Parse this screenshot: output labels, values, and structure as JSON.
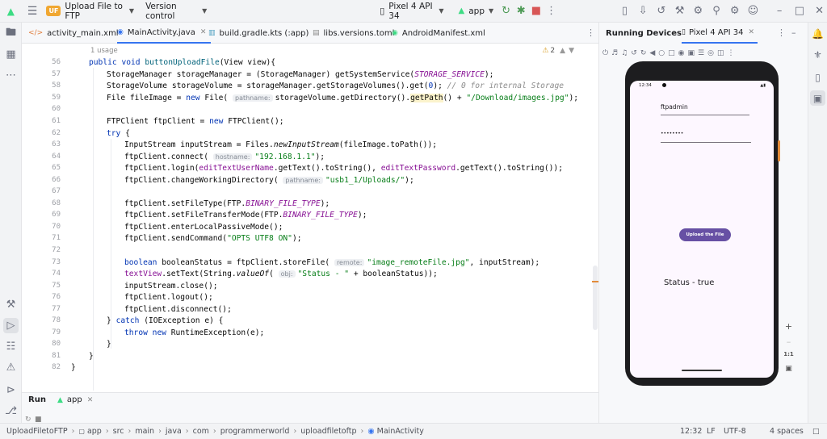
{
  "titlebar": {
    "project_badge": "UF",
    "project_name": "Upload File to FTP",
    "vcs": "Version control",
    "device": "Pixel 4 API 34",
    "run_config": "app"
  },
  "tabs": [
    "activity_main.xml",
    "MainActivity.java",
    "build.gradle.kts (:app)",
    "libs.versions.toml",
    "AndroidManifest.xml"
  ],
  "editor": {
    "usage": "1 usage",
    "warnings": "2",
    "line_numbers": [
      "56",
      "57",
      "58",
      "59",
      "60",
      "61",
      "62",
      "63",
      "64",
      "65",
      "66",
      "67",
      "68",
      "69",
      "70",
      "71",
      "72",
      "73",
      "74",
      "75",
      "76",
      "77",
      "78",
      "79",
      "80",
      "81",
      "82"
    ],
    "hints": {
      "pathname": "pathname:",
      "hostname": "hostname:",
      "remote": "remote:",
      "obj": "obj:"
    },
    "tokens": {
      "l56a": "public",
      "l56b": "void",
      "l56c": "buttonUploadFile",
      "l56d": "(View view){",
      "l57a": "StorageManager storageManager = (StorageManager) getSystemService(",
      "l57b": "STORAGE_SERVICE",
      "l57c": ");",
      "l58a": "StorageVolume storageVolume = storageManager.getStorageVolumes().get(",
      "l58b": "0",
      "l58c": "); ",
      "l58d": "// 0 for internal Storage",
      "l59a": "File fileImage = ",
      "l59b": "new",
      "l59c": "File(",
      "l59d": "storageVolume.getDirectory().",
      "l59e": "getPath",
      "l59f": "() + ",
      "l59g": "\"/Download/images.jpg\"",
      "l59h": ");",
      "l61a": "FTPClient ftpClient = ",
      "l61b": "new",
      "l61c": "FTPClient();",
      "l62": "try",
      "l62b": " {",
      "l63a": "InputStream inputStream = Files.",
      "l63b": "newInputStream",
      "l63c": "(fileImage.toPath());",
      "l64a": "ftpClient.connect(",
      "l64b": "\"192.168.1.1\"",
      "l64c": ");",
      "l65a": "ftpClient.login(",
      "l65b": "editTextUserName",
      "l65c": ".getText().toString(), ",
      "l65d": "editTextPassword",
      "l65e": ".getText().toString());",
      "l66a": "ftpClient.changeWorkingDirectory(",
      "l66b": "\"usb1_1/Uploads/\"",
      "l66c": ");",
      "l68a": "ftpClient.setFileType(FTP.",
      "l68b": "BINARY_FILE_TYPE",
      "l68c": ");",
      "l69a": "ftpClient.setFileTransferMode(FTP.",
      "l69b": "BINARY_FILE_TYPE",
      "l69c": ");",
      "l70": "ftpClient.enterLocalPassiveMode();",
      "l71a": "ftpClient.sendCommand(",
      "l71b": "\"OPTS UTF8 ON\"",
      "l71c": ");",
      "l73a": "boolean",
      "l73b": " booleanStatus = ftpClient.storeFile(",
      "l73c": "\"image_remoteFile.jpg\"",
      "l73d": ", inputStream);",
      "l74a": "textView",
      "l74b": ".setText(String.",
      "l74c": "valueOf",
      "l74d": "(",
      "l74e": "\"Status - \"",
      "l74f": " + booleanStatus));",
      "l75": "inputStream.close();",
      "l76": "ftpClient.logout();",
      "l77": "ftpClient.disconnect();",
      "l78a": "} ",
      "l78b": "catch",
      "l78c": " (IOException e) {",
      "l79a": "throw",
      "l79b": " ",
      "l79c": "new",
      "l79d": " RuntimeException(e);",
      "l80": "}",
      "l81": "}",
      "l82": "}"
    }
  },
  "run": {
    "tab_run": "Run",
    "tab_app": "app"
  },
  "devices": {
    "title": "Running Devices",
    "device_tab": "Pixel 4 API 34"
  },
  "phone": {
    "time": "12:34",
    "username": "ftpadmin",
    "password": "••••••••",
    "button": "Upload the File",
    "status": "Status - true",
    "zoom_label": "1:1"
  },
  "breadcrumb": [
    "UploadFiletoFTP",
    "app",
    "src",
    "main",
    "java",
    "com",
    "programmerworld",
    "uploadfiletoftp",
    "MainActivity"
  ],
  "status": {
    "position": "12:32",
    "line_sep": "LF",
    "encoding": "UTF-8",
    "indent": "4 spaces"
  },
  "colors": {
    "accent": "#3574f0",
    "button": "#6750a4"
  }
}
